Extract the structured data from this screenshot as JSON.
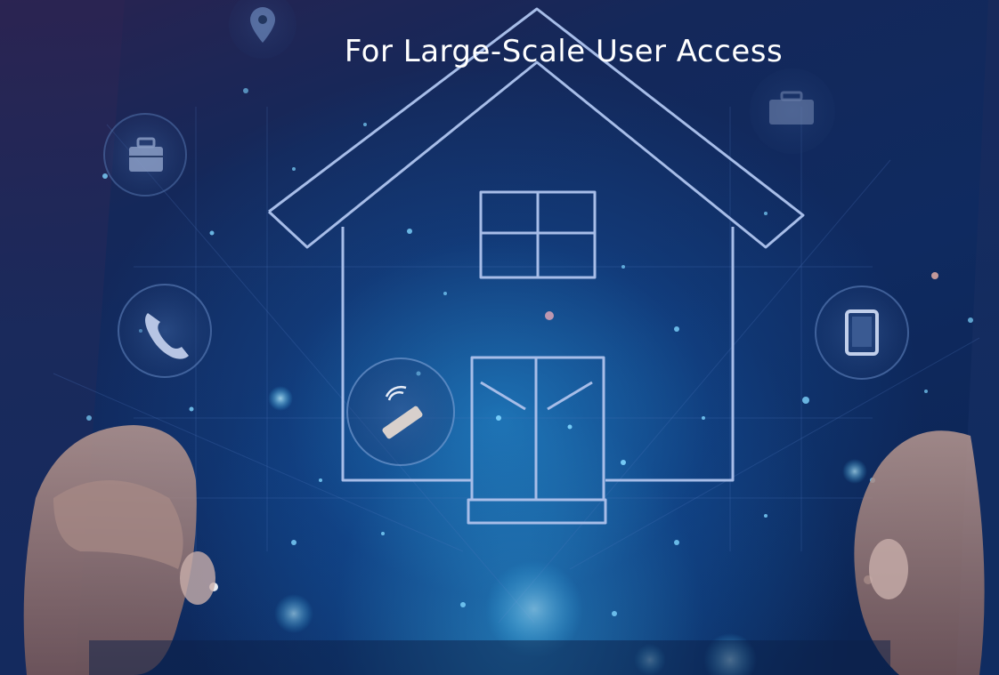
{
  "headline": {
    "text": "For Large-Scale User Access"
  },
  "colors": {
    "background": "#0f2a60",
    "accent_glow": "#3cc8ff",
    "line": "#9fb8e6",
    "headline": "#ffffff"
  },
  "icons": [
    "location-pin-icon",
    "briefcase-icon",
    "toolbox-icon",
    "phone-icon",
    "tablet-icon",
    "wifi-card-icon",
    "house-icon"
  ]
}
